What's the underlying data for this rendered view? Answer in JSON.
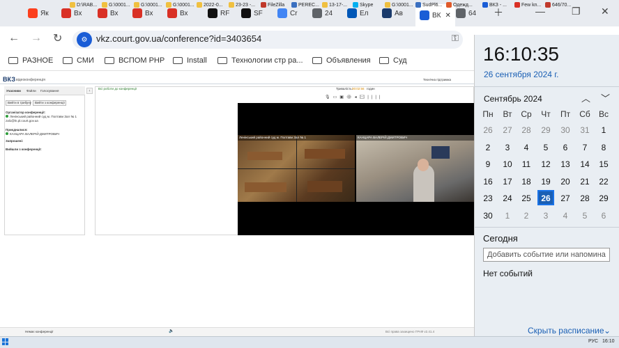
{
  "browser": {
    "tabs": [
      {
        "label": "Як",
        "icon": "yandex-icon",
        "color": "#fc3f1d"
      },
      {
        "label": "Вх",
        "icon": "gmail-icon",
        "color": "#d93025"
      },
      {
        "label": "Вх",
        "icon": "gmail-icon",
        "color": "#d93025"
      },
      {
        "label": "Вх",
        "icon": "gmail-icon",
        "color": "#d93025"
      },
      {
        "label": "Вх",
        "icon": "gmail-icon",
        "color": "#d93025"
      },
      {
        "label": "RF",
        "icon": "d-icon",
        "color": "#111111"
      },
      {
        "label": "SF",
        "icon": "raz-icon",
        "color": "#111111"
      },
      {
        "label": "Cr",
        "icon": "google-icon",
        "color": "#4285f4"
      },
      {
        "label": "24",
        "icon": "globe-icon",
        "color": "#5f6368"
      },
      {
        "label": "Ел",
        "icon": "ukraine-flag-icon",
        "color": "#0057b7"
      },
      {
        "label": "Ав",
        "icon": "shield-icon",
        "color": "#1a3a6b"
      },
      {
        "label": "ВК",
        "icon": "vkz-icon",
        "color": "#1a5dd6"
      },
      {
        "label": "64",
        "icon": "globe-icon",
        "color": "#5f6368"
      }
    ],
    "url": "vkz.court.gov.ua/conference?id=3403654",
    "bookmarks": [
      "РАЗНОЕ",
      "СМИ",
      "ВСПОМ PHP",
      "Install",
      "Технологии стр ра...",
      "Объявления",
      "Суд"
    ]
  },
  "vkz": {
    "logo": "ВКЗ",
    "logo_sub": "відеоконференція",
    "support": "Технічна підтримка",
    "tabs": [
      "Учасники",
      "Файли",
      "Голосування"
    ],
    "btn_tribune": "Вийти в трибуну",
    "btn_leave": "Вийти з конференції",
    "organizer_title": "Організатор конференції:",
    "organizer_name": "Ленінський районний суд м. Полтави Зал № 1",
    "organizer_mail": "zal1@ln.pl.court.gov.ua",
    "joined_title": "Приєдналися:",
    "joined_name": "КАНЦАРА ВАЛЕРІЙ ДМИТРОВИЧ",
    "invited_title": "Запрошені:",
    "left_title": "Вийшли з конференції:",
    "back_link": "Всі роботи до конференції",
    "duration_label": "Тривалість:",
    "duration_value": "00:02:56",
    "duration_unit": "годин",
    "tile1_label": "Ленінський районний суд м. Полтави Зал № 1",
    "tile2_label": "КАНЦАРА ВАЛЕРІЙ ДМИТРОВИЧ",
    "footer_status": "Немає конференції",
    "footer_right": "Всі права захищено ГРАФ v2.41.4"
  },
  "calendar": {
    "time": "16:10:35",
    "date_long": "26 сентября 2024 г.",
    "month_title": "Сентябрь 2024",
    "weekdays": [
      "Пн",
      "Вт",
      "Ср",
      "Чт",
      "Пт",
      "Сб",
      "Вс"
    ],
    "weeks": [
      [
        "26",
        "27",
        "28",
        "29",
        "30",
        "31",
        "1"
      ],
      [
        "2",
        "3",
        "4",
        "5",
        "6",
        "7",
        "8"
      ],
      [
        "9",
        "10",
        "11",
        "12",
        "13",
        "14",
        "15"
      ],
      [
        "16",
        "17",
        "18",
        "19",
        "20",
        "21",
        "22"
      ],
      [
        "23",
        "24",
        "25",
        "26",
        "27",
        "28",
        "29"
      ],
      [
        "30",
        "1",
        "2",
        "3",
        "4",
        "5",
        "6"
      ]
    ],
    "today": "26",
    "today_color": "#1a5fb4",
    "schedule_title": "Сегодня",
    "add_event_placeholder": "Добавить событие или напомина",
    "no_events": "Нет событий",
    "hide_schedule": "Скрыть расписание"
  },
  "taskbar": {
    "items": [
      "D:\\RAB...",
      "G:\\0001...",
      "G:\\0001...",
      "G:\\0001...",
      "2022-0...",
      "23-23 -...",
      "FileZilla",
      "PEREC...",
      "13-17-...",
      "Skype",
      "G:\\0001...",
      "SudPl6...",
      "Одежд...",
      "ВКЗ - ...",
      "Few kn...",
      "646/70..."
    ],
    "lang": "РУС",
    "time": "16:10"
  }
}
